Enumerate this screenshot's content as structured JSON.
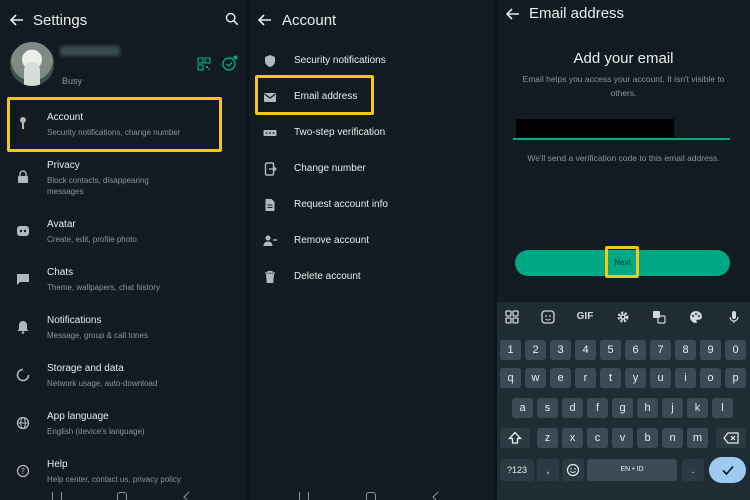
{
  "settings": {
    "title": "Settings",
    "profile_status": "Busy",
    "items": [
      {
        "title": "Account",
        "subtitle": "Security notifications, change number",
        "icon": "key-icon"
      },
      {
        "title": "Privacy",
        "subtitle": "Block contacts, disappearing messages",
        "icon": "lock-icon"
      },
      {
        "title": "Avatar",
        "subtitle": "Create, edit, profile photo",
        "icon": "avatar-icon"
      },
      {
        "title": "Chats",
        "subtitle": "Theme, wallpapers, chat history",
        "icon": "chat-icon"
      },
      {
        "title": "Notifications",
        "subtitle": "Message, group & call tones",
        "icon": "bell-icon"
      },
      {
        "title": "Storage and data",
        "subtitle": "Network usage, auto-download",
        "icon": "storage-icon"
      },
      {
        "title": "App language",
        "subtitle": "English (device's language)",
        "icon": "globe-icon"
      },
      {
        "title": "Help",
        "subtitle": "Help center, contact us, privacy policy",
        "icon": "help-icon"
      }
    ]
  },
  "account": {
    "title": "Account",
    "items": [
      {
        "label": "Security notifications",
        "icon": "shield-icon"
      },
      {
        "label": "Email address",
        "icon": "mail-icon"
      },
      {
        "label": "Two-step verification",
        "icon": "dots-icon"
      },
      {
        "label": "Change number",
        "icon": "phone-transfer-icon"
      },
      {
        "label": "Request account info",
        "icon": "document-icon"
      },
      {
        "label": "Remove account",
        "icon": "remove-user-icon"
      },
      {
        "label": "Delete account",
        "icon": "trash-icon"
      }
    ]
  },
  "email": {
    "title": "Email address",
    "heading": "Add your email",
    "description": "Email helps you access your account. It isn't visible to others.",
    "note": "We'll send a verification code to this email address.",
    "next_label": "Next"
  },
  "keyboard": {
    "toolbar": {
      "gif": "GIF"
    },
    "row_numbers": [
      "1",
      "2",
      "3",
      "4",
      "5",
      "6",
      "7",
      "8",
      "9",
      "0"
    ],
    "row_top": [
      "q",
      "w",
      "e",
      "r",
      "t",
      "y",
      "u",
      "i",
      "o",
      "p"
    ],
    "row_mid": [
      "a",
      "s",
      "d",
      "f",
      "g",
      "h",
      "j",
      "k",
      "l"
    ],
    "row_bottom": [
      "z",
      "x",
      "c",
      "v",
      "b",
      "n",
      "m"
    ],
    "symbols_key": "?123",
    "comma": ",",
    "space_label": "EN • ID",
    "period": "."
  },
  "colors": {
    "accent": "#00a884",
    "highlight": "#f5c518",
    "background": "#111b21"
  }
}
